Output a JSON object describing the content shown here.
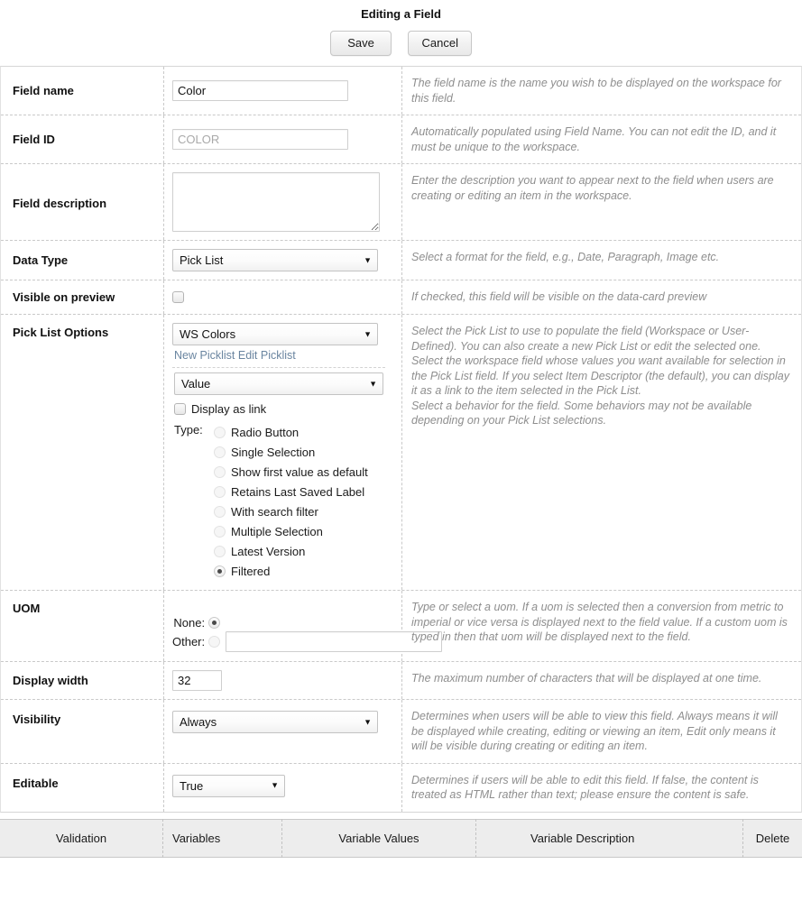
{
  "header": {
    "title": "Editing a Field",
    "save_label": "Save",
    "cancel_label": "Cancel"
  },
  "rows": {
    "field_name": {
      "label": "Field name",
      "value": "Color",
      "help": "The field name is the name you wish to be displayed on the workspace for this field."
    },
    "field_id": {
      "label": "Field ID",
      "value": "COLOR",
      "help": "Automatically populated using Field Name. You can not edit the ID, and it must be unique to the workspace."
    },
    "field_description": {
      "label": "Field description",
      "value": "",
      "help": "Enter the description you want to appear next to the field when users are creating or editing an item in the workspace."
    },
    "data_type": {
      "label": "Data Type",
      "value": "Pick List",
      "help": "Select a format for the field, e.g., Date, Paragraph, Image etc."
    },
    "visible_on_preview": {
      "label": "Visible on preview",
      "checked": false,
      "help": "If checked, this field will be visible on the data-card preview"
    },
    "pick_list_options": {
      "label": "Pick List Options",
      "picklist_value": "WS Colors",
      "new_picklist_label": "New Picklist",
      "edit_picklist_label": "Edit Picklist",
      "field_value": "Value",
      "display_as_link_label": "Display as link",
      "display_as_link_checked": false,
      "type_label": "Type:",
      "types": [
        {
          "label": "Radio Button",
          "selected": false,
          "enabled": false
        },
        {
          "label": "Single Selection",
          "selected": false,
          "enabled": false
        },
        {
          "label": "Show first value as default",
          "selected": false,
          "enabled": false
        },
        {
          "label": "Retains Last Saved Label",
          "selected": false,
          "enabled": false
        },
        {
          "label": "With search filter",
          "selected": false,
          "enabled": false
        },
        {
          "label": "Multiple Selection",
          "selected": false,
          "enabled": false
        },
        {
          "label": "Latest Version",
          "selected": false,
          "enabled": false
        },
        {
          "label": "Filtered",
          "selected": true,
          "enabled": true
        }
      ],
      "help_1": "Select the Pick List to use to populate the field (Workspace or User-Defined). You can also create a new Pick List or edit the selected one.",
      "help_2": "Select the workspace field whose values you want available for selection in the Pick List field. If you select Item Descriptor (the default), you can display it as a link to the item selected in the Pick List.",
      "help_3": "Select a behavior for the field. Some behaviors may not be available depending on your Pick List selections."
    },
    "uom": {
      "label": "UOM",
      "none_label": "None:",
      "none_selected": true,
      "other_label": "Other:",
      "other_selected": false,
      "other_value": "",
      "help": "Type or select a uom. If a uom is selected then a conversion from metric to imperial or vice versa is displayed next to the field value. If a custom uom is typed in then that uom will be displayed next to the field."
    },
    "display_width": {
      "label": "Display width",
      "value": "32",
      "help": "The maximum number of characters that will be displayed at one time."
    },
    "visibility": {
      "label": "Visibility",
      "value": "Always",
      "help": "Determines when users will be able to view this field. Always means it will be displayed while creating, editing or viewing an item, Edit only means it will be visible during creating or editing an item."
    },
    "editable": {
      "label": "Editable",
      "value": "True",
      "help": "Determines if users will be able to edit this field. If false, the content is treated as HTML rather than text; please ensure the content is safe."
    }
  },
  "footer": {
    "columns": [
      "Validation",
      "Variables",
      "Variable Values",
      "Variable Description",
      "Delete"
    ]
  }
}
